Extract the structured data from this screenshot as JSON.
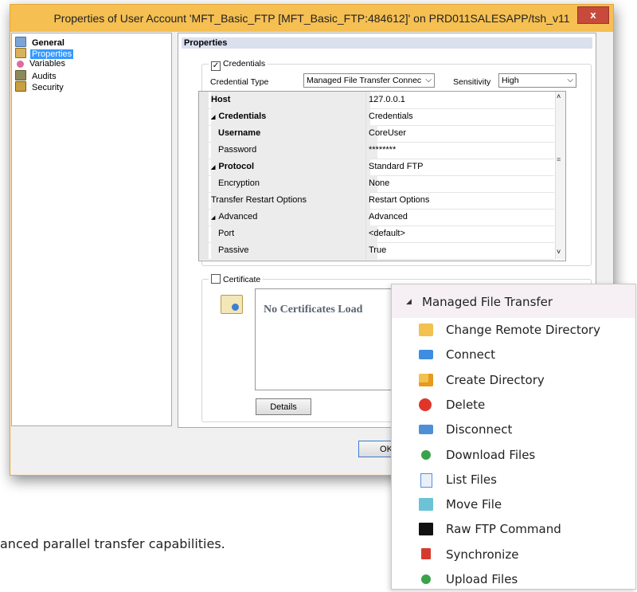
{
  "window": {
    "title": "Properties of User Account 'MFT_Basic_FTP [MFT_Basic_FTP:484612]' on PRD011SALESAPP/tsh_v11",
    "close_glyph": "x"
  },
  "nav": {
    "items": [
      {
        "label": "General",
        "icon": "general-icon"
      },
      {
        "label": "Properties",
        "icon": "properties-icon"
      },
      {
        "label": "Variables",
        "icon": "variables-icon"
      },
      {
        "label": "Audits",
        "icon": "audits-icon"
      },
      {
        "label": "Security",
        "icon": "security-icon"
      }
    ]
  },
  "properties": {
    "header": "Properties",
    "credentials_group": {
      "checkbox_label": "Credentials",
      "checked": true,
      "credential_type_label": "Credential Type",
      "credential_type_value": "Managed File Transfer Connec",
      "sensitivity_label": "Sensitivity",
      "sensitivity_value": "High"
    },
    "grid": [
      {
        "name": "Host",
        "value": "127.0.0.1"
      },
      {
        "name": "Credentials",
        "value": "Credentials",
        "expander": "◢"
      },
      {
        "name": "Username",
        "value": "CoreUser"
      },
      {
        "name": "Password",
        "value": "********"
      },
      {
        "name": "Protocol",
        "value": "Standard FTP",
        "expander": "◢"
      },
      {
        "name": "Encryption",
        "value": "None"
      },
      {
        "name": "Transfer Restart Options",
        "value": "Restart Options"
      },
      {
        "name": "Advanced",
        "value": "Advanced",
        "expander": "◢"
      },
      {
        "name": "Port",
        "value": "<default>"
      },
      {
        "name": "Passive",
        "value": "True"
      }
    ],
    "certificate_group": {
      "checkbox_label": "Certificate",
      "checked": false,
      "empty_text": "No Certificates Load",
      "details_button": "Details"
    },
    "ok_button": "OK"
  },
  "context_menu": {
    "header": "Managed File Transfer",
    "items": [
      {
        "label": "Change Remote Directory",
        "icon": "folder-icon"
      },
      {
        "label": "Connect",
        "icon": "connect-icon"
      },
      {
        "label": "Create Directory",
        "icon": "new-folder-icon"
      },
      {
        "label": "Delete",
        "icon": "delete-icon"
      },
      {
        "label": "Disconnect",
        "icon": "disconnect-icon"
      },
      {
        "label": "Download Files",
        "icon": "download-icon"
      },
      {
        "label": "List Files",
        "icon": "list-files-icon"
      },
      {
        "label": "Move File",
        "icon": "move-file-icon"
      },
      {
        "label": "Raw FTP Command",
        "icon": "terminal-icon"
      },
      {
        "label": "Synchronize",
        "icon": "synchronize-icon"
      },
      {
        "label": "Upload Files",
        "icon": "upload-icon"
      }
    ]
  },
  "background_text": "anced parallel transfer capabilities.",
  "colors": {
    "titlebar": "#f5bf52",
    "selection": "#3399ff",
    "close_button": "#c74a3c"
  }
}
